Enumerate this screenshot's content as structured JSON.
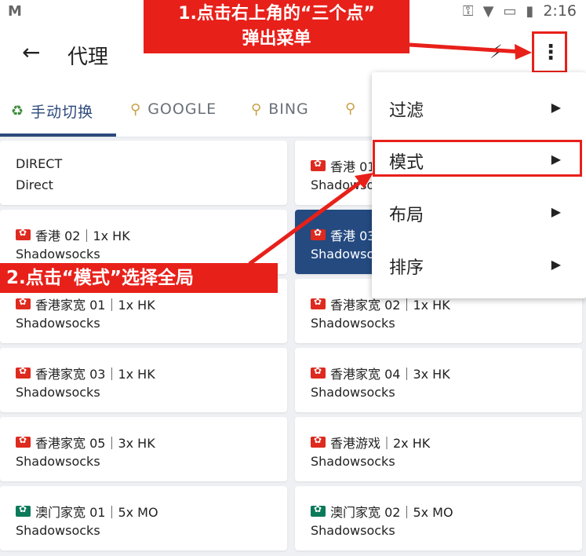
{
  "status_bar": {
    "app_icon": "gmail-icon",
    "time": "2:16",
    "icons": [
      "key-icon",
      "wifi-icon",
      "no-sim-icon",
      "battery-icon"
    ]
  },
  "app_bar": {
    "title": "代理",
    "back_icon": "arrow-left-icon",
    "bolt_icon": "bolt-icon",
    "more_icon": "more-vert-icon"
  },
  "tabs": [
    {
      "label": "手动切换",
      "icon": "recycle-icon",
      "active": true
    },
    {
      "label": "GOOGLE",
      "icon": "search-icon",
      "active": false
    },
    {
      "label": "BING",
      "icon": "search-icon",
      "active": false
    },
    {
      "label": "",
      "icon": "search-icon",
      "active": false
    }
  ],
  "proxies": [
    {
      "name": "DIRECT",
      "type": "Direct",
      "flag": ""
    },
    {
      "name": "香港 01",
      "type": "Shadowsocks",
      "flag": "hk"
    },
    {
      "name": "香港 02｜1x HK",
      "type": "Shadowsocks",
      "flag": "hk"
    },
    {
      "name": "香港 03",
      "type": "Shadowsocks",
      "flag": "hk",
      "selected": true
    },
    {
      "name": "香港家宽 01｜1x HK",
      "type": "Shadowsocks",
      "flag": "hk"
    },
    {
      "name": "香港家宽 02｜1x HK",
      "type": "Shadowsocks",
      "flag": "hk"
    },
    {
      "name": "香港家宽 03｜1x HK",
      "type": "Shadowsocks",
      "flag": "hk"
    },
    {
      "name": "香港家宽 04｜3x HK",
      "type": "Shadowsocks",
      "flag": "hk"
    },
    {
      "name": "香港家宽 05｜3x HK",
      "type": "Shadowsocks",
      "flag": "hk"
    },
    {
      "name": "香港游戏｜2x HK",
      "type": "Shadowsocks",
      "flag": "hk"
    },
    {
      "name": "澳门家宽 01｜5x MO",
      "type": "Shadowsocks",
      "flag": "mo"
    },
    {
      "name": "澳门家宽 02｜5x MO",
      "type": "Shadowsocks",
      "flag": "mo"
    }
  ],
  "menu": {
    "items": [
      {
        "label": "过滤"
      },
      {
        "label": "模式"
      },
      {
        "label": "布局"
      },
      {
        "label": "排序"
      }
    ]
  },
  "annotations": {
    "step1_line1": "1.点击右上角的“三个点”",
    "step1_line2": "弹出菜单",
    "step2": "2.点击“模式”选择全局",
    "color": "#e8201a"
  }
}
